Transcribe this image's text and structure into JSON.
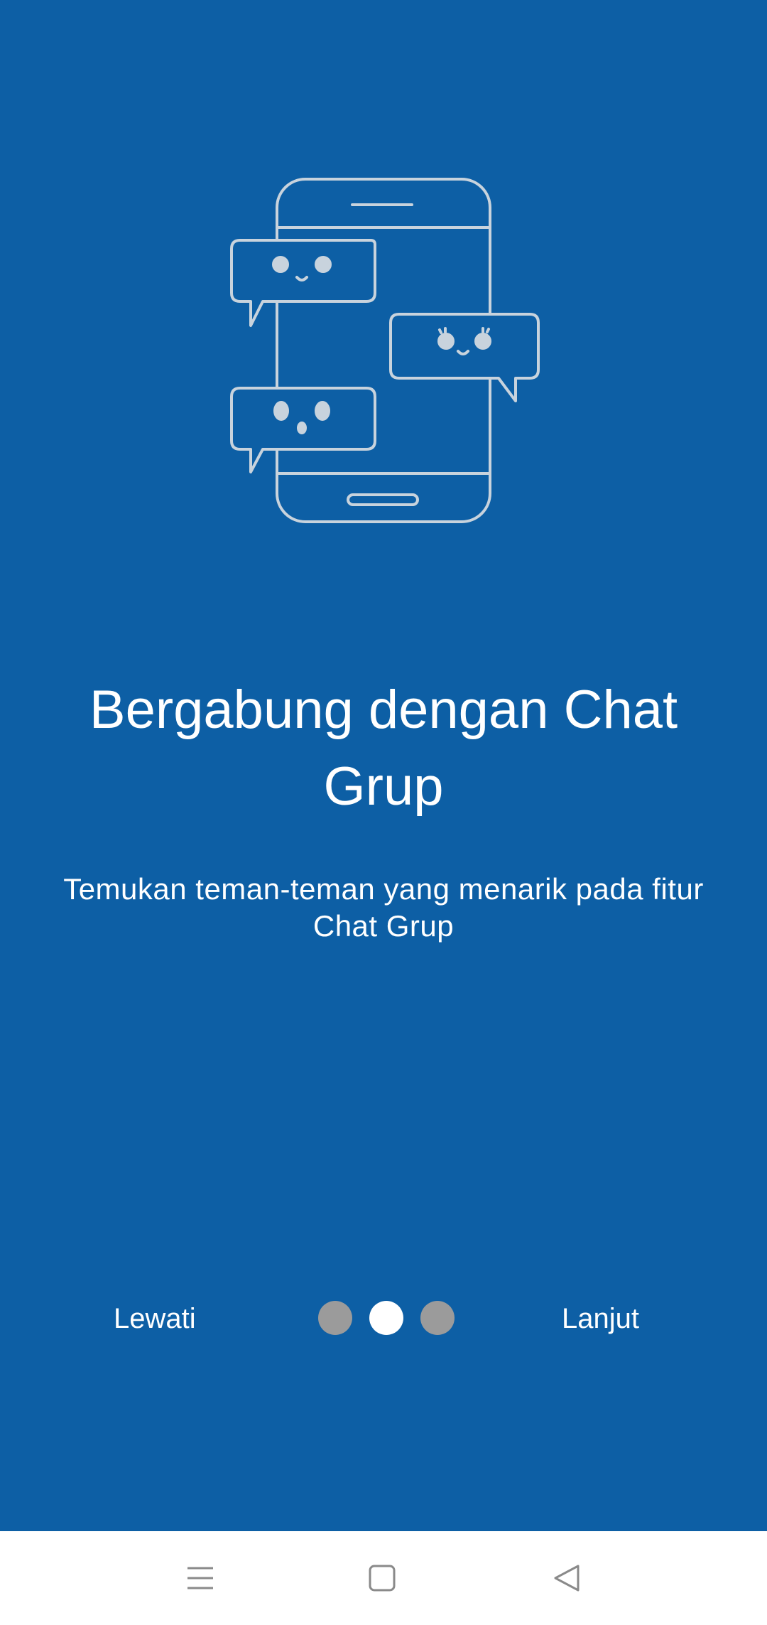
{
  "onboarding": {
    "title": "Bergabung dengan Chat Grup",
    "subtitle": "Temukan teman-teman yang menarik pada fitur Chat Grup",
    "skip_label": "Lewati",
    "next_label": "Lanjut",
    "page_indicator": {
      "total": 3,
      "current": 2
    },
    "illustration_icon": "phone-chat-bubbles-icon"
  },
  "navbar": {
    "icons": [
      "menu-icon",
      "home-icon",
      "back-icon"
    ]
  },
  "colors": {
    "background": "#0d5fa5",
    "text": "#ffffff",
    "dot_inactive": "#9b9b9b",
    "dot_active": "#ffffff",
    "navbar": "#ffffff",
    "illustration_stroke": "#c8d3dd"
  }
}
